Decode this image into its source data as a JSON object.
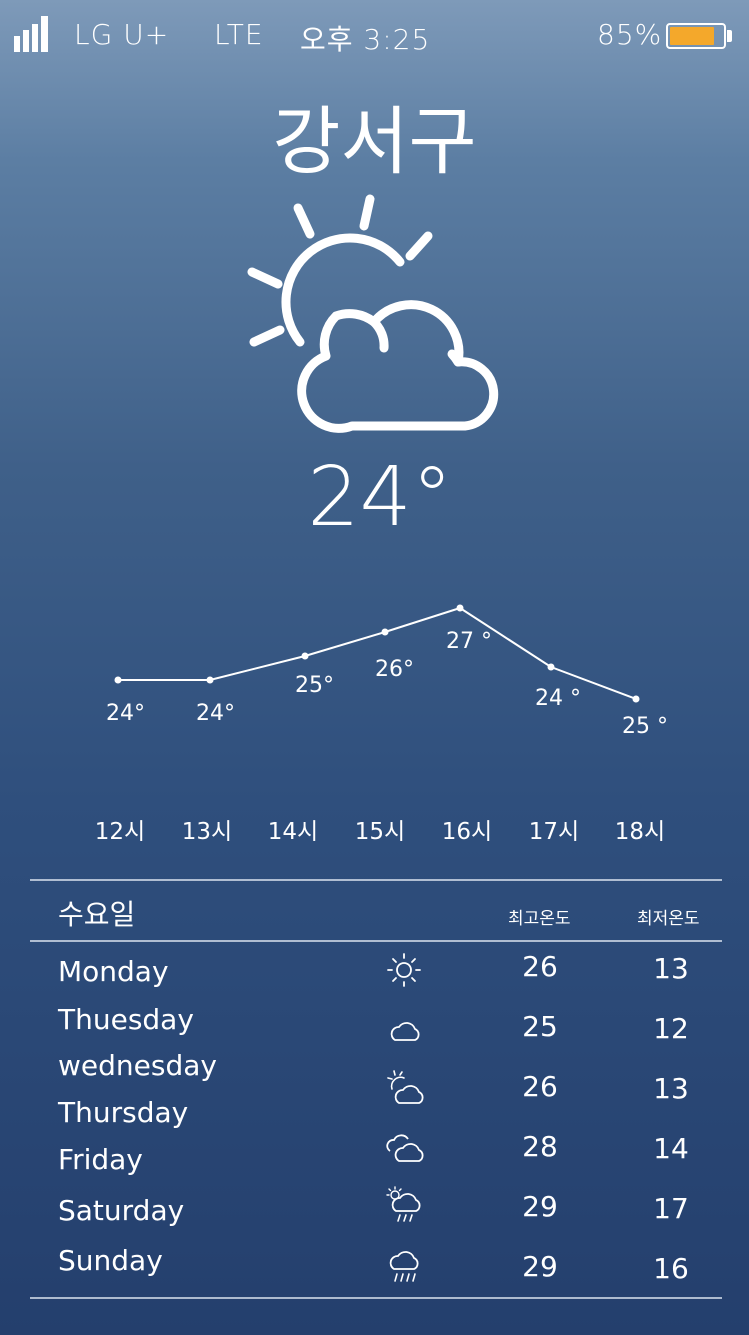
{
  "status_bar": {
    "carrier": "LG  U+",
    "network": "LTE",
    "time": "오후 3:25",
    "battery_text": "85%",
    "battery_level": 0.85,
    "battery_color": "#f4a82b",
    "signal_bars": 4
  },
  "location": {
    "city": "강서구"
  },
  "current": {
    "temperature": "24°",
    "condition_icon": "partly-sunny-cloud-icon"
  },
  "chart_data": {
    "type": "line",
    "categories": [
      "12시",
      "13시",
      "14시",
      "15시",
      "16시",
      "17시",
      "18시"
    ],
    "values": [
      24,
      24,
      25,
      26,
      27,
      24,
      25
    ],
    "point_labels": [
      "24°",
      "24°",
      "25°",
      "26°",
      "27 °",
      "24 °",
      "25 °"
    ]
  },
  "forecast": {
    "header": {
      "title": "수요일",
      "high_label": "최고온도",
      "low_label": "최저온도"
    },
    "days": [
      {
        "name": "Monday",
        "icon": "sun-icon",
        "high": "26",
        "low": "13"
      },
      {
        "name": "Thuesday",
        "icon": "cloud-icon",
        "high": "25",
        "low": "12"
      },
      {
        "name": "wednesday",
        "icon": "sun-behind-cloud-icon",
        "high": "26",
        "low": "13"
      },
      {
        "name": "Thursday",
        "icon": "clouds-icon",
        "high": "28",
        "low": "14"
      },
      {
        "name": "Friday",
        "icon": "sun-rain-cloud-icon",
        "high": "29",
        "low": "17"
      },
      {
        "name": "Saturday",
        "icon": "rain-cloud-icon",
        "high": "29",
        "low": "16"
      },
      {
        "name": "Sunday",
        "icon": "",
        "high": "",
        "low": ""
      }
    ]
  }
}
